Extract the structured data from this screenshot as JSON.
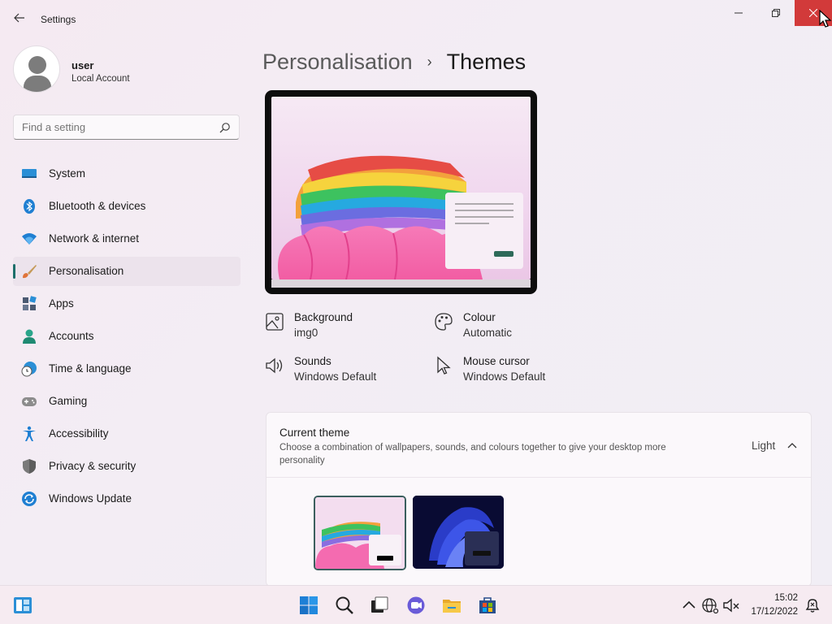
{
  "window": {
    "title": "Settings",
    "back_icon": "back-arrow-icon",
    "minimize_icon": "minimize-icon",
    "maximize_icon": "restore-icon",
    "close_icon": "close-icon"
  },
  "profile": {
    "name": "user",
    "subtitle": "Local Account"
  },
  "search": {
    "placeholder": "Find a setting"
  },
  "sidebar": {
    "items": [
      {
        "label": "System",
        "icon": "system-icon"
      },
      {
        "label": "Bluetooth & devices",
        "icon": "bluetooth-icon"
      },
      {
        "label": "Network & internet",
        "icon": "wifi-icon"
      },
      {
        "label": "Personalisation",
        "icon": "paintbrush-icon",
        "active": true
      },
      {
        "label": "Apps",
        "icon": "apps-icon"
      },
      {
        "label": "Accounts",
        "icon": "accounts-icon"
      },
      {
        "label": "Time & language",
        "icon": "clock-globe-icon"
      },
      {
        "label": "Gaming",
        "icon": "gamepad-icon"
      },
      {
        "label": "Accessibility",
        "icon": "accessibility-icon"
      },
      {
        "label": "Privacy & security",
        "icon": "shield-icon"
      },
      {
        "label": "Windows Update",
        "icon": "update-icon"
      }
    ]
  },
  "breadcrumb": {
    "parent": "Personalisation",
    "separator": "›",
    "current": "Themes"
  },
  "properties": {
    "background": {
      "label": "Background",
      "value": "img0"
    },
    "colour": {
      "label": "Colour",
      "value": "Automatic"
    },
    "sounds": {
      "label": "Sounds",
      "value": "Windows Default"
    },
    "mouse_cursor": {
      "label": "Mouse cursor",
      "value": "Windows Default"
    }
  },
  "current_theme": {
    "title": "Current theme",
    "description": "Choose a combination of wallpapers, sounds, and colours together to give your desktop more personality",
    "value": "Light",
    "themes": [
      {
        "name": "light",
        "selected": true
      },
      {
        "name": "dark",
        "selected": false
      }
    ]
  },
  "taskbar": {
    "time": "15:02",
    "date": "17/12/2022",
    "icons": [
      "widgets-icon",
      "start-icon",
      "search-icon",
      "task-view-icon",
      "chat-icon",
      "file-explorer-icon",
      "store-icon",
      "chevron-up-icon",
      "network-icon",
      "volume-muted-icon",
      "notification-icon"
    ]
  },
  "colors": {
    "accent": "#1d6f6a",
    "close_button": "#d23a3a"
  }
}
